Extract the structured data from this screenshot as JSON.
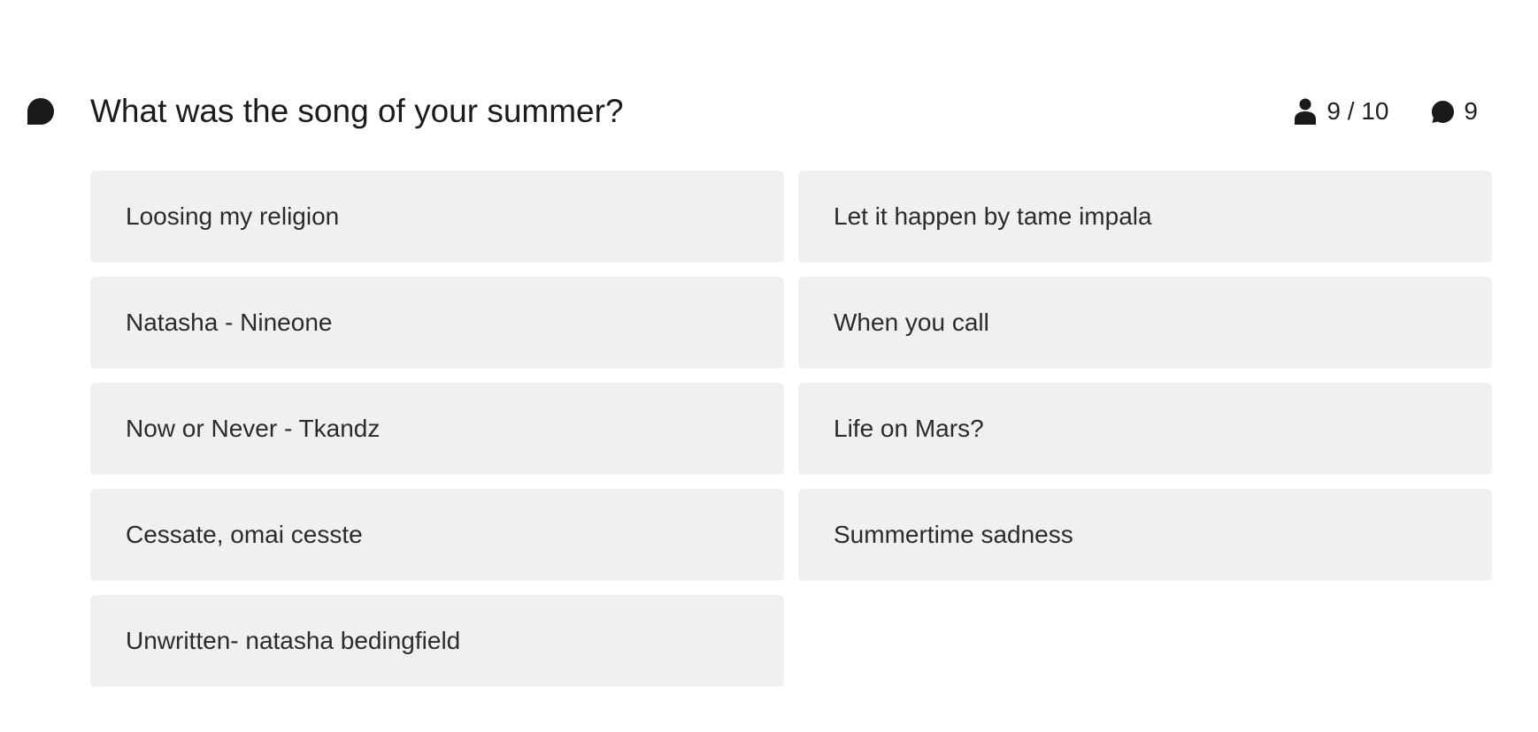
{
  "question": {
    "icon": "speech-bubble-icon",
    "title": "What was the song of your summer?"
  },
  "stats": {
    "participants": {
      "icon": "person-icon",
      "label": "9 / 10"
    },
    "comments": {
      "icon": "comment-bubble-icon",
      "label": "9"
    }
  },
  "answers": [
    "Loosing my religion",
    "Let it happen by tame impala",
    "Natasha - Nineone",
    "When you call",
    "Now or Never - Tkandz",
    "Life on Mars?",
    "Cessate, omai cesste",
    "Summertime sadness",
    "Unwritten- natasha bedingfield"
  ],
  "colors": {
    "card_background": "#f1f0ef",
    "text": "#1f1f1f",
    "icon": "#1a1a1a"
  }
}
